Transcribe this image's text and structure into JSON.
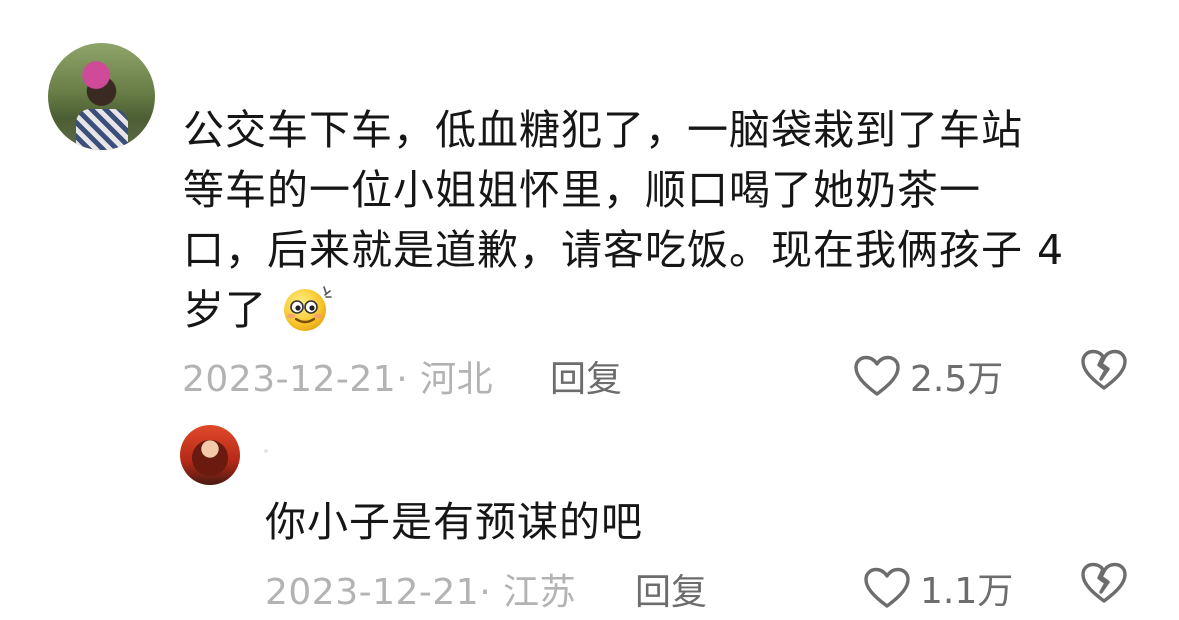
{
  "comments": [
    {
      "text_lines": [
        "公交车下车，低血糖犯了，一脑袋栽到了车站",
        "等车的一位小姐姐怀里，顺口喝了她奶茶一",
        "口，后来就是道歉，请客吃饭。现在我俩孩子 4",
        "岁了"
      ],
      "emoji": "smiling-face-emoji",
      "date": "2023-12-21·",
      "location": "河北",
      "reply_label": "回复",
      "likes": "2.5万"
    },
    {
      "text": "你小子是有预谋的吧",
      "date": "2023-12-21·",
      "location": "江苏",
      "reply_label": "回复",
      "likes": "1.1万"
    }
  ],
  "icons": {
    "like": "heart-outline-icon",
    "dislike": "broken-heart-icon"
  },
  "colors": {
    "text": "#161616",
    "meta": "#b3b3b3",
    "action": "#6d6d6d"
  }
}
